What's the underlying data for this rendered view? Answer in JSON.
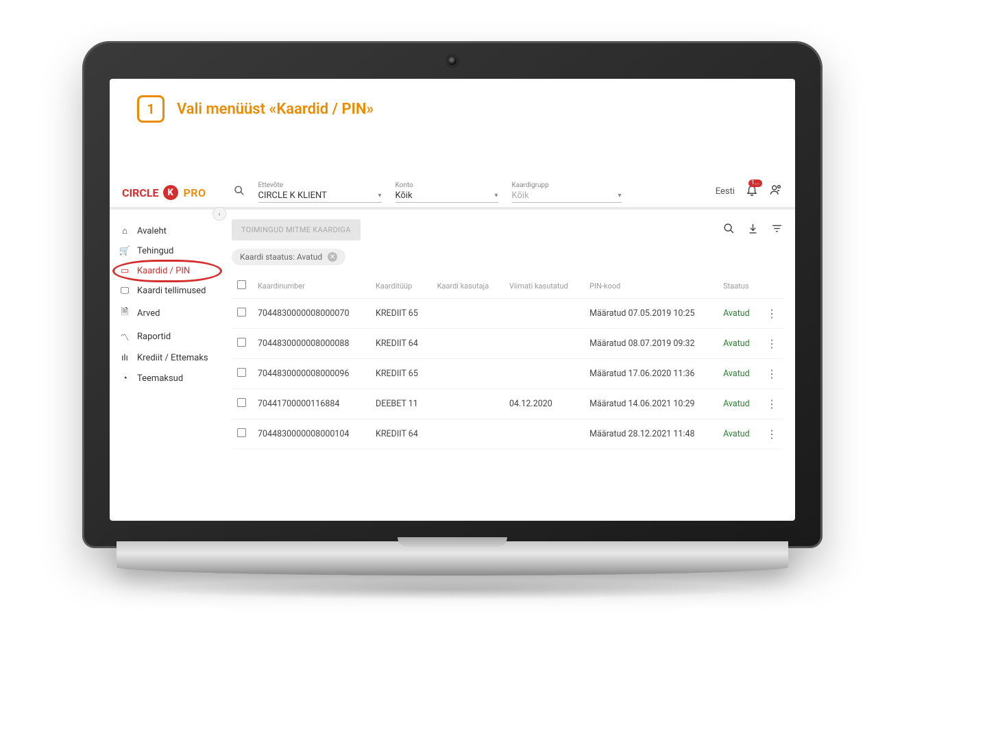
{
  "instruction": {
    "step": "1",
    "text": "Vali menüüst «Kaardid / PIN»"
  },
  "logo": {
    "brand_pre": "CIRCLE",
    "brand_k": "K",
    "pro": "PRO"
  },
  "topbar": {
    "company": {
      "label": "Ettevõte",
      "value": "CIRCLE K KLIENT"
    },
    "account": {
      "label": "Konto",
      "value": "Kõik"
    },
    "cardgroup": {
      "label": "Kaardigrupp",
      "placeholder": "Kõik"
    },
    "language": "Eesti",
    "notifications": "1..."
  },
  "sidebar": {
    "items": [
      {
        "icon": "home",
        "label": "Avaleht"
      },
      {
        "icon": "cart",
        "label": "Tehingud"
      },
      {
        "icon": "card",
        "label": "Kaardid / PIN",
        "active": true
      },
      {
        "icon": "monitor",
        "label": "Kaardi tellimused"
      },
      {
        "icon": "doc",
        "label": "Arved"
      },
      {
        "icon": "chart",
        "label": "Raportid"
      },
      {
        "icon": "bars",
        "label": "Krediit / Ettemaks"
      },
      {
        "icon": "road",
        "label": "Teemaksud"
      }
    ]
  },
  "toolbar": {
    "bulk_label": "TOIMINGUD MITME KAARDIGA",
    "filter_chip": "Kaardi staatus: Avatud"
  },
  "table": {
    "headers": {
      "cardnumber": "Kaardinumber",
      "cardtype": "Kaarditüüp",
      "carduser": "Kaardi kasutaja",
      "lastused": "Viimati kasutatud",
      "pin": "PIN-kood",
      "status": "Staatus"
    },
    "rows": [
      {
        "cardnumber": "7044830000008000070",
        "cardtype": "KREDIIT 65",
        "carduser": "",
        "lastused": "",
        "pin": "Määratud 07.05.2019 10:25",
        "status": "Avatud"
      },
      {
        "cardnumber": "7044830000008000088",
        "cardtype": "KREDIIT 64",
        "carduser": "",
        "lastused": "",
        "pin": "Määratud 08.07.2019 09:32",
        "status": "Avatud"
      },
      {
        "cardnumber": "7044830000008000096",
        "cardtype": "KREDIIT 65",
        "carduser": "",
        "lastused": "",
        "pin": "Määratud 17.06.2020 11:36",
        "status": "Avatud"
      },
      {
        "cardnumber": "70441700000116884",
        "cardtype": "DEEBET 11",
        "carduser": "",
        "lastused": "04.12.2020",
        "pin": "Määratud 14.06.2021 10:29",
        "status": "Avatud"
      },
      {
        "cardnumber": "7044830000008000104",
        "cardtype": "KREDIIT 64",
        "carduser": "",
        "lastused": "",
        "pin": "Määratud 28.12.2021 11:48",
        "status": "Avatud"
      }
    ]
  },
  "icons": {
    "home": "⌂",
    "cart": "🛒",
    "card": "▭",
    "monitor": "🖵",
    "doc": "🗎",
    "chart": "〽",
    "bars": "ılı",
    "road": "◔"
  }
}
